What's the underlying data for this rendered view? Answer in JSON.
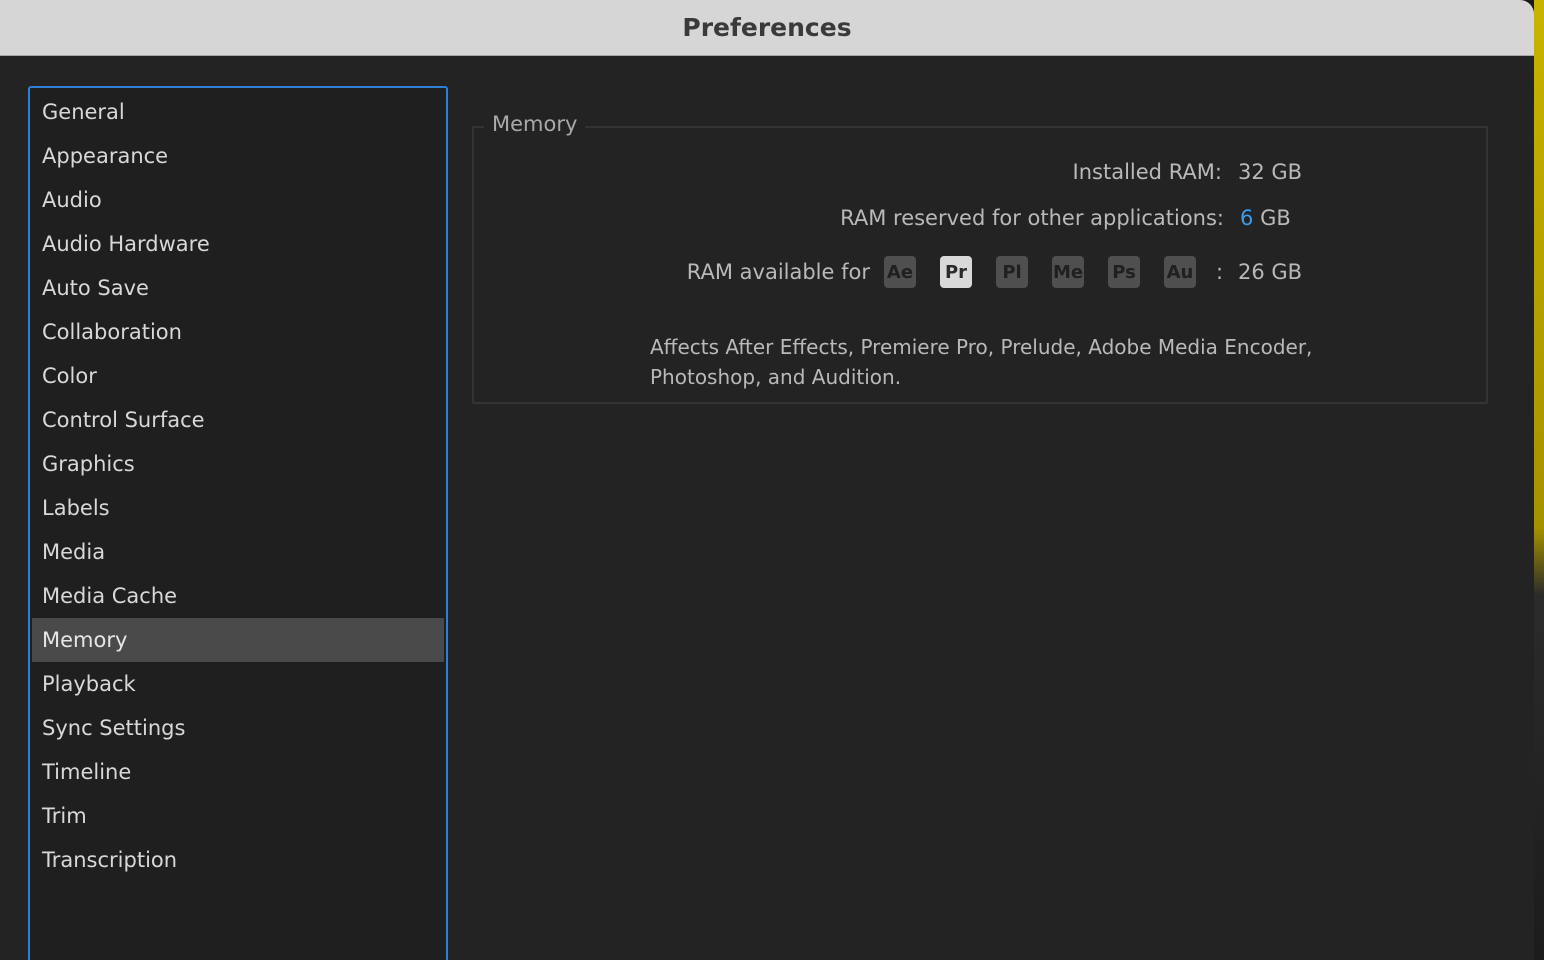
{
  "window": {
    "title": "Preferences"
  },
  "sidebar": {
    "items": [
      {
        "label": "General"
      },
      {
        "label": "Appearance"
      },
      {
        "label": "Audio"
      },
      {
        "label": "Audio Hardware"
      },
      {
        "label": "Auto Save"
      },
      {
        "label": "Collaboration"
      },
      {
        "label": "Color"
      },
      {
        "label": "Control Surface"
      },
      {
        "label": "Graphics"
      },
      {
        "label": "Labels"
      },
      {
        "label": "Media"
      },
      {
        "label": "Media Cache"
      },
      {
        "label": "Memory"
      },
      {
        "label": "Playback"
      },
      {
        "label": "Sync Settings"
      },
      {
        "label": "Timeline"
      },
      {
        "label": "Trim"
      },
      {
        "label": "Transcription"
      }
    ],
    "selected": "Memory"
  },
  "memory": {
    "section_title": "Memory",
    "installed_label": "Installed RAM:",
    "installed_value": "32 GB",
    "reserved_label": "RAM reserved for other applications:",
    "reserved_value": "6",
    "reserved_unit": "GB",
    "available_label": "RAM available for",
    "apps": [
      {
        "abbr": "Ae",
        "active": false
      },
      {
        "abbr": "Pr",
        "active": true
      },
      {
        "abbr": "Pl",
        "active": false
      },
      {
        "abbr": "Me",
        "active": false
      },
      {
        "abbr": "Ps",
        "active": false
      },
      {
        "abbr": "Au",
        "active": false
      }
    ],
    "available_separator": ":",
    "available_value": "26 GB",
    "affects_line1": "Affects After Effects, Premiere Pro, Prelude, Adobe Media Encoder,",
    "affects_line2": "Photoshop, and Audition."
  },
  "colors": {
    "accent": "#3d9be9",
    "selection_border": "#2f7fd6",
    "window_bg": "#232323",
    "titlebar_bg": "#d6d6d6"
  }
}
